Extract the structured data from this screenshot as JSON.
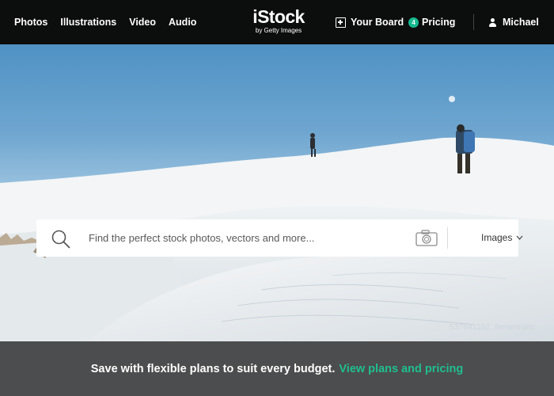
{
  "nav": {
    "left_items": [
      "Photos",
      "Illustrations",
      "Video",
      "Audio"
    ],
    "logo_word": "iStock",
    "logo_sub": "by Getty Images",
    "board_label": "Your Board",
    "board_count": "4",
    "pricing_label": "Pricing",
    "user_name": "Michael"
  },
  "search": {
    "placeholder": "Find the perfect stock photos, vectors and more...",
    "type_label": "Images"
  },
  "hero": {
    "credit": "537641152, ferrantraite"
  },
  "promo": {
    "text": "Save with flexible plans to suit every budget.",
    "link": "View plans and pricing"
  },
  "colors": {
    "nav_bg": "#0c0d0d",
    "accent": "#17b890",
    "promo_bg": "#4c4d4e",
    "link": "#1fbf8f"
  }
}
